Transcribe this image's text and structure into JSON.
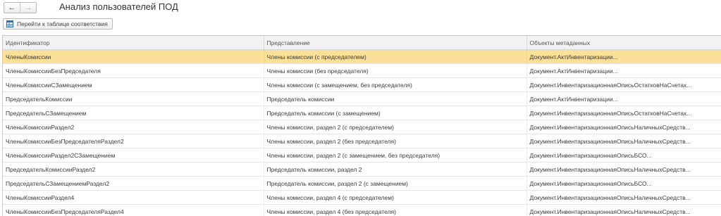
{
  "window": {
    "title": "Анализ пользователей ПОД",
    "back_glyph": "←",
    "forward_glyph": "→"
  },
  "toolbar": {
    "goto_label": "Перейти к таблице соответствия"
  },
  "table": {
    "columns": [
      "Идентификатор",
      "Представление",
      "Объекты метаданных"
    ],
    "selected_row": 0,
    "rows": [
      [
        "ЧленыКомиссии",
        "Члены комиссии (с председателем)",
        "Документ.АктИнвентаризации..."
      ],
      [
        "ЧленыКомиссииБезПредседателя",
        "Члены комиссии (без председателя)",
        "Документ.АктИнвентаризации..."
      ],
      [
        "ЧленыКомиссииСЗамещением",
        "Члены комиссии (с замещением, без председателя)",
        "Документ.ИнвентаризационнаяОписьОстатковНаСчетах..."
      ],
      [
        "ПредседательКомиссии",
        "Председатель комиссии",
        "Документ.АктИнвентаризации..."
      ],
      [
        "ПредседательСЗамещением",
        "Председатель комиссии (с замещением)",
        "Документ.ИнвентаризационнаяОписьОстатковНаСчетах..."
      ],
      [
        "ЧленыКомиссииРаздел2",
        "Члены комиссии, раздел 2 (с председателем)",
        "Документ.ИнвентаризационнаяОписьНаличныхСредств..."
      ],
      [
        "ЧленыКомиссииБезПредседателяРаздел2",
        "Члены комиссии, раздел 2 (без председателя)",
        "Документ.ИнвентаризационнаяОписьНаличныхСредств..."
      ],
      [
        "ЧленыКомиссииРаздел2СЗамещением",
        "Члены комиссии, раздел 2 (с замещением, без председателя)",
        "Документ.ИнвентаризационнаяОписьБСО..."
      ],
      [
        "ПредседательКомиссииРаздел2",
        "Председатель комиссии, раздел 2",
        "Документ.ИнвентаризационнаяОписьНаличныхСредств..."
      ],
      [
        "ПредседательСЗамещениемРаздел2",
        "Председатель комиссии, раздел 2 (с замещением)",
        "Документ.ИнвентаризационнаяОписьБСО..."
      ],
      [
        "ЧленыКомиссииРаздел4",
        "Члены комиссии, раздел 4 (с председателем)",
        "Документ.ИнвентаризационнаяОписьНаличныхСредств..."
      ],
      [
        "ЧленыКомиссииБезПредседателяРаздел4",
        "Члены комиссии, раздел 4 (без председателя)",
        "Документ.ИнвентаризационнаяОписьНаличныхСредств..."
      ]
    ]
  },
  "colors": {
    "selection": "#fbe09a",
    "header_bg": "#f2f2f2",
    "icon_blue": "#2f6fb5"
  },
  "icons": {
    "goto": "table-link-icon"
  }
}
